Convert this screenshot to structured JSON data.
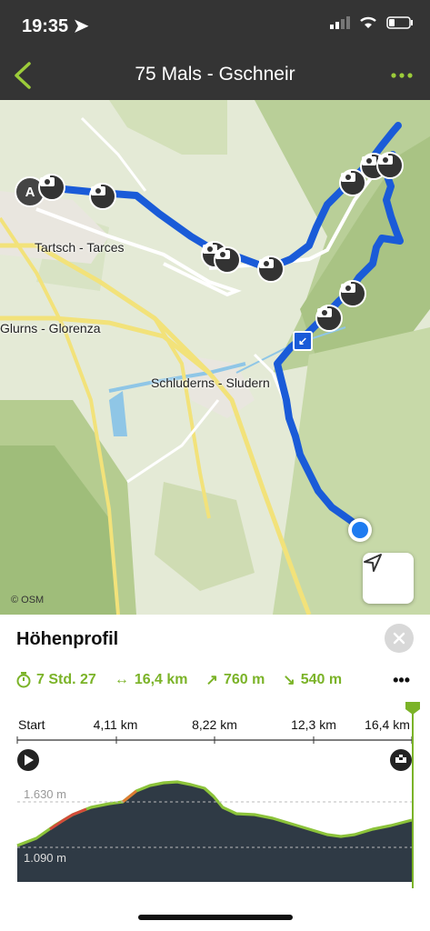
{
  "status": {
    "time": "19:35"
  },
  "nav": {
    "title": "75 Mals - Gschneir"
  },
  "map": {
    "labels": {
      "tartsch": "Tartsch - Tarces",
      "glurns": "Glurns - Glorenza",
      "schluderns": "Schluderns - Sludern"
    },
    "start_marker": "A",
    "attribution": "© OSM"
  },
  "panel": {
    "title": "Höhenprofil",
    "stats": {
      "duration": "7 Std. 27",
      "distance": "16,4 km",
      "ascent": "760 m",
      "descent": "540 m"
    },
    "axis": {
      "ticks": [
        "Start",
        "4,11 km",
        "8,22 km",
        "12,3 km",
        "16,4 km"
      ],
      "y_high": "1.630 m",
      "y_low": "1.090 m"
    }
  },
  "colors": {
    "accent": "#7bb328",
    "route": "#1a5bd8",
    "profile_fill": "#2f3a45"
  }
}
